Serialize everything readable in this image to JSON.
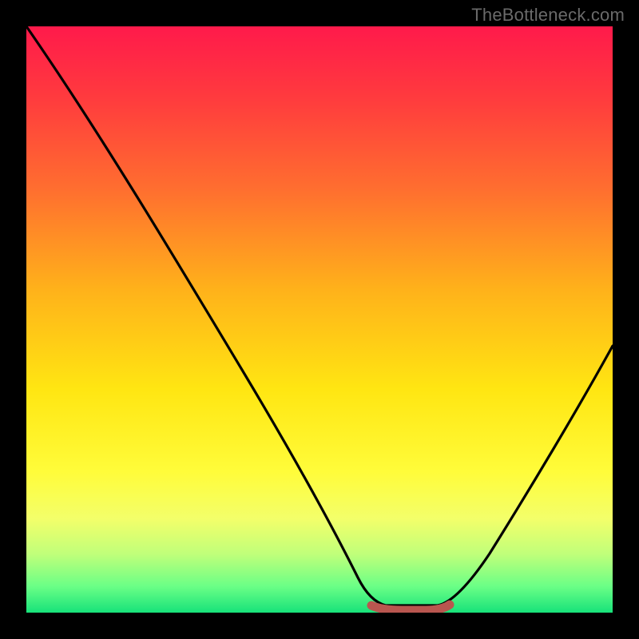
{
  "watermark": {
    "text": "TheBottleneck.com"
  },
  "colors": {
    "frame": "#000000",
    "curve": "#000000",
    "flat_segment": "#b9564f",
    "watermark_text": "#6a6a6a"
  },
  "gradient": {
    "stops": [
      {
        "offset": 0.0,
        "color": "#ff1a4b"
      },
      {
        "offset": 0.12,
        "color": "#ff3a3e"
      },
      {
        "offset": 0.28,
        "color": "#ff6f2f"
      },
      {
        "offset": 0.45,
        "color": "#ffb21a"
      },
      {
        "offset": 0.62,
        "color": "#ffe612"
      },
      {
        "offset": 0.76,
        "color": "#fffc3a"
      },
      {
        "offset": 0.84,
        "color": "#f3ff6a"
      },
      {
        "offset": 0.9,
        "color": "#c0ff7a"
      },
      {
        "offset": 0.955,
        "color": "#6bff86"
      },
      {
        "offset": 1.0,
        "color": "#17e27a"
      }
    ]
  },
  "chart_data": {
    "type": "line",
    "title": "",
    "xlabel": "",
    "ylabel": "",
    "xlim": [
      0,
      100
    ],
    "ylim": [
      0,
      100
    ],
    "note": "Axes are unlabeled percentages; values estimated from pixel positions.",
    "series": [
      {
        "name": "curve",
        "x": [
          0,
          5,
          10,
          15,
          20,
          25,
          30,
          35,
          40,
          45,
          50,
          55,
          58.5,
          62,
          68,
          72,
          76,
          80,
          84,
          88,
          92,
          96,
          100
        ],
        "y": [
          100,
          92,
          84,
          76,
          68,
          60,
          51.5,
          43,
          34,
          25.5,
          17,
          9,
          3,
          0,
          0,
          2.5,
          7,
          13,
          20,
          28,
          37,
          46,
          56
        ]
      }
    ],
    "flat_segment": {
      "x_start": 58.5,
      "x_end": 71,
      "y": 1.2,
      "color": "#b9564f"
    }
  }
}
